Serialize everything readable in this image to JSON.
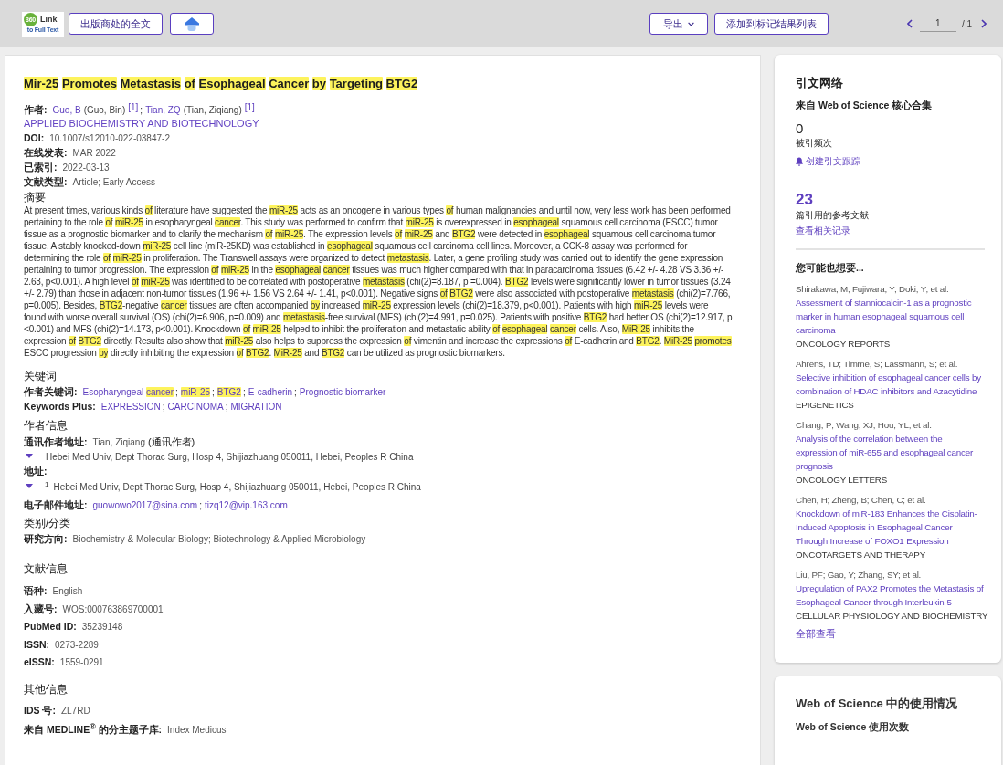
{
  "toolbar": {
    "logo": {
      "badge": "360",
      "name": "Link",
      "tagline": "to Full Text"
    },
    "full_text_button": "出版商处的全文",
    "export_button": "导出",
    "marked_list_button": "添加到标记结果列表",
    "pagination": {
      "page": "1",
      "total": "/ 1"
    }
  },
  "record": {
    "title": [
      {
        "text": "Mir-25",
        "highlighted": true
      },
      {
        "text": " Promotes",
        "highlighted": true
      },
      {
        "text": " Metastasis",
        "highlighted": true
      },
      {
        "text": " of",
        "highlighted": true
      },
      {
        "text": " Esophageal",
        "highlighted": true
      },
      {
        "text": " Cancer",
        "highlighted": true
      },
      {
        "text": " by",
        "highlighted": true
      },
      {
        "text": " Targeting",
        "highlighted": true
      },
      {
        "text": " BTG2",
        "highlighted": true
      }
    ],
    "authors": {
      "label": "作者:",
      "separator": ";",
      "items": [
        {
          "short": "Guo, B",
          "full": "(Guo, Bin)",
          "ref": "[1]"
        },
        {
          "short": "Tian, ZQ",
          "full": "(Tian, Ziqiang)",
          "ref": "[1]"
        }
      ]
    },
    "journal": "APPLIED BIOCHEMISTRY AND BIOTECHNOLOGY",
    "details": [
      {
        "label": "DOI:",
        "value": "10.1007/s12010-022-03847-2"
      },
      {
        "label": "在线发表:",
        "value": "MAR 2022"
      },
      {
        "label": "已索引:",
        "value": "2022-03-13"
      },
      {
        "label": "文献类型:",
        "value": "Article; Early Access"
      }
    ],
    "abstract": {
      "heading": "摘要",
      "segments": [
        {
          "text": "At present times, various kinds ",
          "highlighted": false
        },
        {
          "text": "of",
          "highlighted": true
        },
        {
          "text": " literature have suggested the ",
          "highlighted": false
        },
        {
          "text": "miR-25",
          "highlighted": true
        },
        {
          "text": " acts as an oncogene in various types ",
          "highlighted": false
        },
        {
          "text": "of",
          "highlighted": true
        },
        {
          "text": " human malignancies and until now, very less work has been performed pertaining to the role ",
          "highlighted": false
        },
        {
          "text": "of",
          "highlighted": true
        },
        {
          "text": " miR-25",
          "highlighted": true
        },
        {
          "text": " in esopharyngeal ",
          "highlighted": false
        },
        {
          "text": "cancer",
          "highlighted": true
        },
        {
          "text": ". This study was performed to confirm that ",
          "highlighted": false
        },
        {
          "text": "miR-25",
          "highlighted": true
        },
        {
          "text": " is overexpressed in ",
          "highlighted": false
        },
        {
          "text": "esophageal",
          "highlighted": true
        },
        {
          "text": " squamous cell carcinoma (ESCC) tumor tissue as a prognostic biomarker and to clarify the mechanism ",
          "highlighted": false
        },
        {
          "text": "of",
          "highlighted": true
        },
        {
          "text": " miR-25",
          "highlighted": true
        },
        {
          "text": ". The expression levels ",
          "highlighted": false
        },
        {
          "text": "of",
          "highlighted": true
        },
        {
          "text": " miR-25",
          "highlighted": true
        },
        {
          "text": " and ",
          "highlighted": false
        },
        {
          "text": "BTG2",
          "highlighted": true
        },
        {
          "text": " were detected in ",
          "highlighted": false
        },
        {
          "text": "esophageal",
          "highlighted": true
        },
        {
          "text": " squamous cell carcinoma tumor tissue. A stably knocked-down ",
          "highlighted": false
        },
        {
          "text": "miR-25",
          "highlighted": true
        },
        {
          "text": " cell line (miR-25KD) was established in ",
          "highlighted": false
        },
        {
          "text": "esophageal",
          "highlighted": true
        },
        {
          "text": " squamous cell carcinoma cell lines. Moreover, a CCK-8 assay was performed for determining the role ",
          "highlighted": false
        },
        {
          "text": "of",
          "highlighted": true
        },
        {
          "text": " miR-25",
          "highlighted": true
        },
        {
          "text": " in proliferation. The Transwell assays were organized to detect ",
          "highlighted": false
        },
        {
          "text": "metastasis",
          "highlighted": true
        },
        {
          "text": ". Later, a gene profiling study was carried out to identify the gene expression pertaining to tumor progression. The expression ",
          "highlighted": false
        },
        {
          "text": "of",
          "highlighted": true
        },
        {
          "text": " miR-25",
          "highlighted": true
        },
        {
          "text": " in the ",
          "highlighted": false
        },
        {
          "text": "esophageal",
          "highlighted": true
        },
        {
          "text": " cancer",
          "highlighted": true
        },
        {
          "text": " tissues was much higher compared with that in paracarcinoma tissues (6.42 +/- 4.28 VS 3.36 +/- 2.63, p<0.001). A high level ",
          "highlighted": false
        },
        {
          "text": "of",
          "highlighted": true
        },
        {
          "text": " miR-25",
          "highlighted": true
        },
        {
          "text": " was identified to be correlated with postoperative ",
          "highlighted": false
        },
        {
          "text": "metastasis",
          "highlighted": true
        },
        {
          "text": " (chi(2)=8.187, p =0.004). ",
          "highlighted": false
        },
        {
          "text": "BTG2",
          "highlighted": true
        },
        {
          "text": " levels were significantly lower in tumor tissues (3.24 +/- 2.79) than those in adjacent non-tumor tissues (1.96 +/- 1.56 VS 2.64 +/- 1.41, p<0.001). Negative signs ",
          "highlighted": false
        },
        {
          "text": "of",
          "highlighted": true
        },
        {
          "text": " BTG2",
          "highlighted": true
        },
        {
          "text": " were also associated with postoperative ",
          "highlighted": false
        },
        {
          "text": "metastasis",
          "highlighted": true
        },
        {
          "text": " (chi(2)=7.766, p=0.005). Besides, ",
          "highlighted": false
        },
        {
          "text": "BTG2",
          "highlighted": true
        },
        {
          "text": "-negative ",
          "highlighted": false
        },
        {
          "text": "cancer",
          "highlighted": true
        },
        {
          "text": " tissues are often accompanied ",
          "highlighted": false
        },
        {
          "text": "by",
          "highlighted": true
        },
        {
          "text": " increased ",
          "highlighted": false
        },
        {
          "text": "miR-25",
          "highlighted": true
        },
        {
          "text": " expression levels (chi(2)=18.379, p<0.001). Patients with high ",
          "highlighted": false
        },
        {
          "text": "miR-25",
          "highlighted": true
        },
        {
          "text": " levels were found with worse overall survival (OS) (chi(2)=6.906, p=0.009) and ",
          "highlighted": false
        },
        {
          "text": "metastasis",
          "highlighted": true
        },
        {
          "text": "-free survival (MFS) (chi(2)=4.991, p=0.025). Patients with positive ",
          "highlighted": false
        },
        {
          "text": "BTG2",
          "highlighted": true
        },
        {
          "text": " had better OS (chi(2)=12.917, p <0.001) and MFS (chi(2)=14.173, p<0.001). Knockdown ",
          "highlighted": false
        },
        {
          "text": "of",
          "highlighted": true
        },
        {
          "text": " miR-25",
          "highlighted": true
        },
        {
          "text": " helped to inhibit the proliferation and metastatic ability ",
          "highlighted": false
        },
        {
          "text": "of",
          "highlighted": true
        },
        {
          "text": " esophageal",
          "highlighted": true
        },
        {
          "text": " cancer",
          "highlighted": true
        },
        {
          "text": " cells. Also, ",
          "highlighted": false
        },
        {
          "text": "MiR-25",
          "highlighted": true
        },
        {
          "text": " inhibits the expression ",
          "highlighted": false
        },
        {
          "text": "of",
          "highlighted": true
        },
        {
          "text": " BTG2",
          "highlighted": true
        },
        {
          "text": " directly. Results also show that ",
          "highlighted": false
        },
        {
          "text": "miR-25",
          "highlighted": true
        },
        {
          "text": " also helps to suppress the expression ",
          "highlighted": false
        },
        {
          "text": "of",
          "highlighted": true
        },
        {
          "text": " vimentin and increase the expressions ",
          "highlighted": false
        },
        {
          "text": "of",
          "highlighted": true
        },
        {
          "text": " E-cadherin and ",
          "highlighted": false
        },
        {
          "text": "BTG2",
          "highlighted": true
        },
        {
          "text": ". ",
          "highlighted": false
        },
        {
          "text": "MiR-25",
          "highlighted": true
        },
        {
          "text": " promotes",
          "highlighted": true
        },
        {
          "text": " ESCC progression ",
          "highlighted": false
        },
        {
          "text": "by",
          "highlighted": true
        },
        {
          "text": " directly inhibiting the expression ",
          "highlighted": false
        },
        {
          "text": "of",
          "highlighted": true
        },
        {
          "text": " BTG2",
          "highlighted": true
        },
        {
          "text": ". ",
          "highlighted": false
        },
        {
          "text": "MiR-25",
          "highlighted": true
        },
        {
          "text": " and ",
          "highlighted": false
        },
        {
          "text": "BTG2",
          "highlighted": true
        },
        {
          "text": " can be utilized as prognostic biomarkers.",
          "highlighted": false
        }
      ]
    },
    "keywords": {
      "heading": "关键词",
      "author_keywords": {
        "label": "作者关键词:",
        "separator": ";",
        "items": [
          {
            "segments": [
              {
                "text": "Esopharyngeal ",
                "highlighted": false
              },
              {
                "text": "cancer",
                "highlighted": true
              }
            ]
          },
          {
            "segments": [
              {
                "text": "miR-25",
                "highlighted": true
              }
            ]
          },
          {
            "segments": [
              {
                "text": "BTG2",
                "highlighted": true
              }
            ]
          },
          {
            "segments": [
              {
                "text": "E-cadherin",
                "highlighted": false
              }
            ]
          },
          {
            "segments": [
              {
                "text": "Prognostic biomarker",
                "highlighted": false
              }
            ]
          }
        ]
      },
      "keywords_plus": {
        "label": "Keywords Plus:",
        "separator": ";",
        "items": [
          "EXPRESSION",
          "CARCINOMA",
          "MIGRATION"
        ]
      }
    },
    "author_info": {
      "heading": "作者信息",
      "corresponding": {
        "label": "通讯作者地址:",
        "name": "Tian, Ziqiang",
        "role": "(通讯作者)",
        "address": "Hebei Med Univ, Dept Thorac Surg, Hosp 4, Shijiazhuang 050011, Hebei, Peoples R China"
      },
      "addresses": {
        "label": "地址:",
        "items": [
          {
            "number": "1",
            "address": "Hebei Med Univ, Dept Thorac Surg, Hosp 4, Shijiazhuang 050011, Hebei, Peoples R China"
          }
        ]
      },
      "emails": {
        "label": "电子邮件地址:",
        "separator": ";",
        "items": [
          "guowowo2017@sina.com",
          "tizq12@vip.163.com"
        ]
      }
    },
    "categories": {
      "heading": "类别/分类",
      "label": "研究方向:",
      "value": "Biochemistry & Molecular Biology; Biotechnology & Applied Microbiology"
    },
    "document_info": {
      "heading": "文献信息",
      "fields": [
        {
          "label": "语种:",
          "value": "English"
        },
        {
          "label": "入藏号:",
          "value": "WOS:000763869700001"
        },
        {
          "label": "PubMed ID:",
          "value": "35239148"
        },
        {
          "label": "ISSN:",
          "value": "0273-2289"
        },
        {
          "label": "eISSN:",
          "value": "1559-0291"
        }
      ]
    },
    "other_info": {
      "heading": "其他信息",
      "fields": [
        {
          "label": "IDS 号:",
          "value": "ZL7RD"
        },
        {
          "label": "来自 MEDLINE$^{®}$ 的分主题子库:",
          "value": "Index Medicus"
        }
      ]
    }
  },
  "citation_network": {
    "heading": "引文网络",
    "source": "来自 Web of Science 核心合集",
    "times_cited": {
      "count": "0",
      "label": "被引频次"
    },
    "alert_link": "创建引文跟踪",
    "references": {
      "count": "23",
      "label": "篇引用的参考文献",
      "link": "查看相关记录"
    },
    "related": {
      "heading": "您可能也想要...",
      "items": [
        {
          "authors": "Shirakawa, M; Fujiwara, Y; Doki, Y; et al.",
          "title": "Assessment of stanniocalcin-1 as a prognostic marker in human esophageal squamous cell carcinoma",
          "journal": "ONCOLOGY REPORTS"
        },
        {
          "authors": "Ahrens, TD; Timme, S; Lassmann, S; et al.",
          "title": "Selective inhibition of esophageal cancer cells by combination of HDAC inhibitors and Azacytidine",
          "journal": "EPIGENETICS"
        },
        {
          "authors": "Chang, P; Wang, XJ; Hou, YL; et al.",
          "title": "Analysis of the correlation between the expression of miR-655 and esophageal cancer prognosis",
          "journal": "ONCOLOGY LETTERS"
        },
        {
          "authors": "Chen, H; Zheng, B; Chen, C; et al.",
          "title": "Knockdown of miR-183 Enhances the Cisplatin-Induced Apoptosis in Esophageal Cancer Through Increase of FOXO1 Expression",
          "journal": "ONCOTARGETS AND THERAPY"
        },
        {
          "authors": "Liu, PF; Gao, Y; Zhang, SY; et al.",
          "title": "Upregulation of PAX2 Promotes the Metastasis of Esophageal Cancer through Interleukin-5",
          "journal": "CELLULAR PHYSIOLOGY AND BIOCHEMISTRY"
        }
      ],
      "view_all": "全部查看"
    }
  },
  "usage": {
    "heading": "Web of Science 中的使用情况",
    "subheading": "Web of Science 使用次数"
  }
}
